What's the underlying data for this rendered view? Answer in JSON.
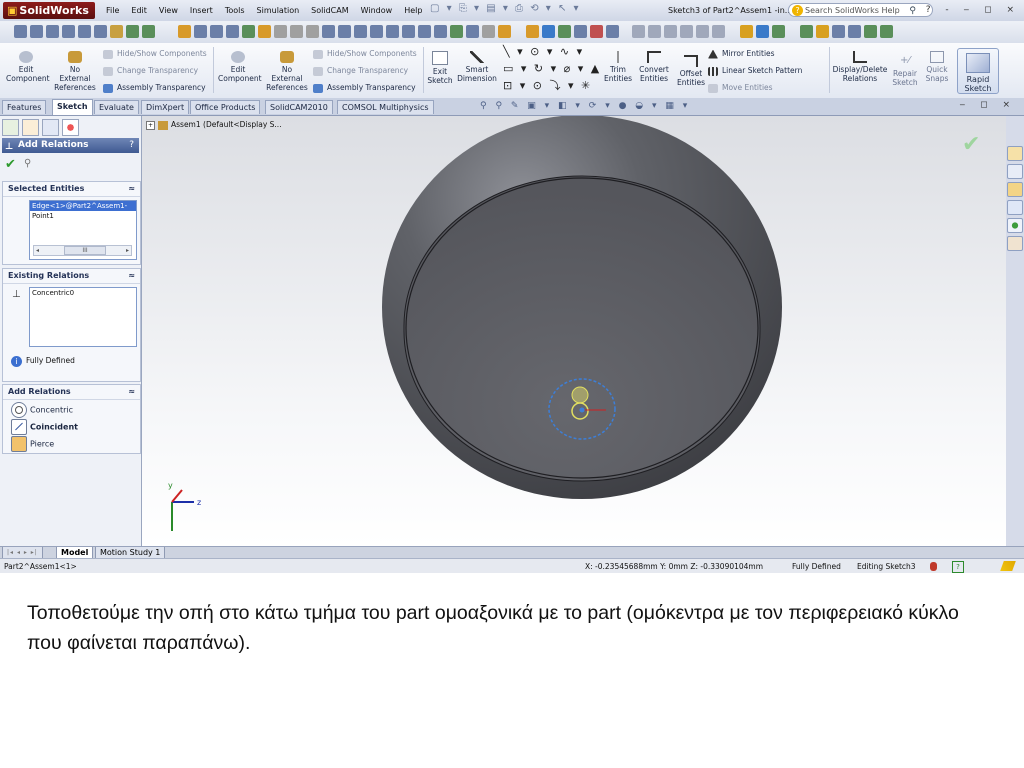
{
  "app": {
    "logo": "SolidWorks",
    "menu": [
      "File",
      "Edit",
      "View",
      "Insert",
      "Tools",
      "Simulation",
      "SolidCAM",
      "Window",
      "Help"
    ],
    "window_title": "Sketch3 of Part2^Assem1 -in...",
    "search_placeholder": "Search SolidWorks Help",
    "help_mark": "?",
    "window_controls": "? - ‒ ◻ ×"
  },
  "command_manager": {
    "edit_component": "Edit\nComponent",
    "no_external": "No\nExternal\nReferences",
    "hide_show": "Hide/Show Components",
    "change_transparency": "Change Transparency",
    "assembly_transparency": "Assembly Transparency",
    "edit_component_2": "Edit\nComponent",
    "no_external_2": "No\nExternal\nReferences",
    "hide_show_2": "Hide/Show Components",
    "change_transparency_2": "Change Transparency",
    "assembly_transparency_2": "Assembly Transparency",
    "exit_sketch": "Exit\nSketch",
    "smart_dimension": "Smart\nDimension",
    "trim_entities": "Trim\nEntities",
    "convert_entities": "Convert\nEntities",
    "offset_entities": "Offset\nEntities",
    "mirror_entities": "Mirror Entities",
    "linear_sketch_pattern": "Linear Sketch Pattern",
    "move_entities": "Move Entities",
    "display_delete_relations": "Display/Delete\nRelations",
    "repair_sketch": "Repair\nSketch",
    "quick_snaps": "Quick\nSnaps",
    "rapid_sketch": "Rapid\nSketch"
  },
  "tabs": [
    "Features",
    "Sketch",
    "Evaluate",
    "DimXpert",
    "Office Products",
    "SolidCAM2010",
    "COMSOL Multiphysics"
  ],
  "property_manager": {
    "title": "Add Relations",
    "help": "?",
    "selected_entities": {
      "title": "Selected Entities",
      "items": [
        "Edge<1>@Part2^Assem1-",
        "Point1"
      ],
      "scroll_thumb": "III"
    },
    "existing_relations": {
      "title": "Existing Relations",
      "items": [
        "Concentric0"
      ],
      "status": "Fully Defined"
    },
    "add_relations": {
      "title": "Add Relations",
      "items": [
        "Concentric",
        "Coincident",
        "Pierce"
      ]
    }
  },
  "viewport": {
    "tree_label": "Assem1  (Default<Display S..."
  },
  "bottom_tabs": [
    "Model",
    "Motion Study 1"
  ],
  "status_bar": {
    "component": "Part2^Assem1<1>",
    "coords": "X: -0.23545688mm Y: 0mm Z: -0.33090104mm",
    "state": "Fully Defined",
    "mode": "Editing Sketch3"
  },
  "caption": "Τοποθετούμε την οπή στο κάτω τμήμα του part ομοαξονικά με το part (ομόκεντρα με τον περιφερειακό κύκλο που φαίνεται παραπάνω).",
  "colors": {
    "accent": "#3f5a92",
    "selection": "#3d6fd1",
    "ok_green": "#2d9a2d",
    "logo_red": "#8d1b1b"
  }
}
